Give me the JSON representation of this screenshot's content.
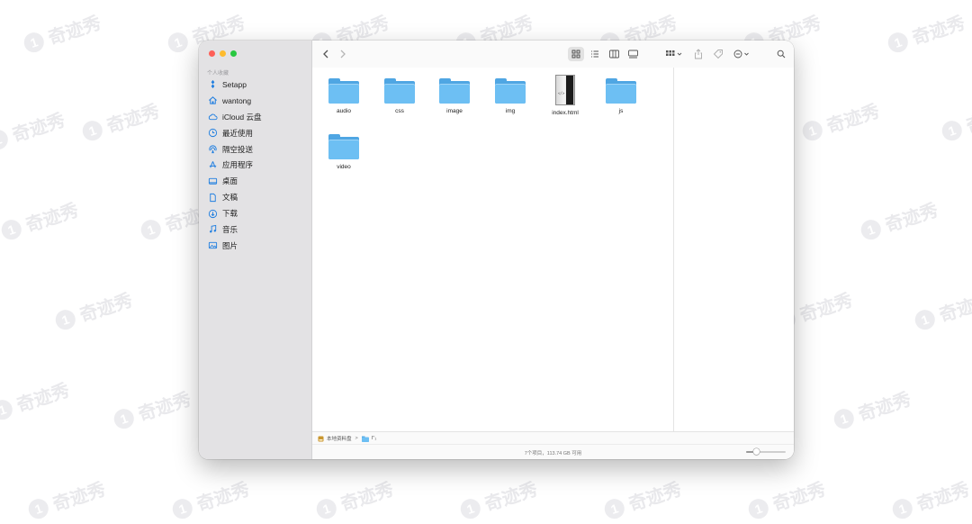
{
  "watermark": {
    "text": "奇迹秀"
  },
  "colors": {
    "folder": "#6dbff3",
    "accent": "#1f7ee0",
    "sidebar_bg": "#e3e2e4"
  },
  "sidebar": {
    "section_title": "个人收藏",
    "items": [
      {
        "label": "Setapp",
        "icon": "setapp-icon"
      },
      {
        "label": "wantong",
        "icon": "home-icon"
      },
      {
        "label": "iCloud 云盘",
        "icon": "cloud-icon"
      },
      {
        "label": "最近使用",
        "icon": "clock-icon"
      },
      {
        "label": "隔空投送",
        "icon": "airdrop-icon"
      },
      {
        "label": "应用程序",
        "icon": "applications-icon"
      },
      {
        "label": "桌面",
        "icon": "desktop-icon"
      },
      {
        "label": "文稿",
        "icon": "document-icon"
      },
      {
        "label": "下载",
        "icon": "download-icon"
      },
      {
        "label": "音乐",
        "icon": "music-icon"
      },
      {
        "label": "图片",
        "icon": "photos-icon"
      }
    ]
  },
  "toolbar": {
    "back": "back-chevron-icon",
    "forward": "forward-chevron-icon",
    "view_modes": [
      "icon-view-icon",
      "list-view-icon",
      "column-view-icon",
      "gallery-view-icon"
    ],
    "active_view": "icon-view-icon"
  },
  "files": [
    {
      "name": "audio",
      "kind": "folder"
    },
    {
      "name": "css",
      "kind": "folder"
    },
    {
      "name": "image",
      "kind": "folder"
    },
    {
      "name": "img",
      "kind": "folder"
    },
    {
      "name": "index.html",
      "kind": "html"
    },
    {
      "name": "js",
      "kind": "folder"
    },
    {
      "name": "video",
      "kind": "folder"
    }
  ],
  "pathbar": {
    "root": "本地资料盘",
    "folder": "I''₁"
  },
  "status": {
    "text": "7个项目，113.74 GB 可用"
  },
  "zoom_level": 0.25
}
